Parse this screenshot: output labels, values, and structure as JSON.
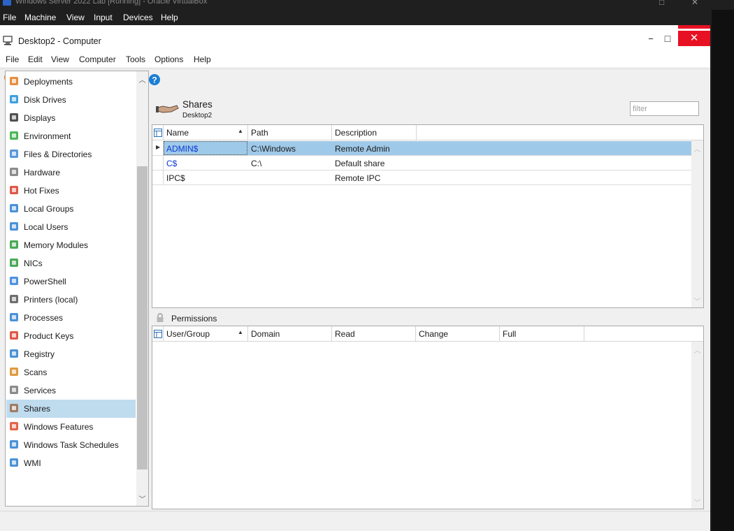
{
  "host": {
    "title": "Windows Server 2022 Lab [Running] - Oracle VirtualBox",
    "menu": [
      "File",
      "Machine",
      "View",
      "Input",
      "Devices",
      "Help"
    ]
  },
  "window": {
    "title": "Desktop2 - Computer",
    "minimize": "−",
    "maximize": "□",
    "close": "✕"
  },
  "menu": [
    "File",
    "Edit",
    "View",
    "Computer",
    "Tools",
    "Options",
    "Help"
  ],
  "toolbar": {
    "icons": [
      "search-icon",
      "tools-icon",
      "print-icon",
      "back-icon",
      "forward-icon",
      "cut-icon",
      "copy-icon",
      "paste-icon",
      "help-icon"
    ]
  },
  "nav": {
    "items": [
      {
        "label": "Deployments",
        "icon": "deployments-icon",
        "color": "#e07a1f"
      },
      {
        "label": "Disk Drives",
        "icon": "disk-icon",
        "color": "#1f8fd8"
      },
      {
        "label": "Displays",
        "icon": "monitor-icon",
        "color": "#333333"
      },
      {
        "label": "Environment",
        "icon": "environment-icon",
        "color": "#2faa3a"
      },
      {
        "label": "Files & Directories",
        "icon": "file-icon",
        "color": "#3d86d6"
      },
      {
        "label": "Hardware",
        "icon": "wrench-icon",
        "color": "#777777"
      },
      {
        "label": "Hot Fixes",
        "icon": "hotfix-icon",
        "color": "#d83b2a"
      },
      {
        "label": "Local Groups",
        "icon": "group-icon",
        "color": "#2c7fd0"
      },
      {
        "label": "Local Users",
        "icon": "user-icon",
        "color": "#2c7fd0"
      },
      {
        "label": "Memory Modules",
        "icon": "memory-icon",
        "color": "#2a9a3a"
      },
      {
        "label": "NICs",
        "icon": "nic-icon",
        "color": "#2a9a3a"
      },
      {
        "label": "PowerShell",
        "icon": "powershell-icon",
        "color": "#2f7fd8"
      },
      {
        "label": "Printers (local)",
        "icon": "printer-icon",
        "color": "#555555"
      },
      {
        "label": "Processes",
        "icon": "processes-icon",
        "color": "#2a7fd0"
      },
      {
        "label": "Product Keys",
        "icon": "key-icon",
        "color": "#d83b2a"
      },
      {
        "label": "Registry",
        "icon": "registry-icon",
        "color": "#2a7fd0"
      },
      {
        "label": "Scans",
        "icon": "search-icon",
        "color": "#d88a1f"
      },
      {
        "label": "Services",
        "icon": "services-icon",
        "color": "#777777"
      },
      {
        "label": "Shares",
        "icon": "share-hand-icon",
        "color": "#9a6a4a"
      },
      {
        "label": "Windows Features",
        "icon": "windows-features-icon",
        "color": "#e0482a"
      },
      {
        "label": "Windows Task Schedules",
        "icon": "calendar-icon",
        "color": "#2a7fd0"
      },
      {
        "label": "WMI",
        "icon": "wmi-icon",
        "color": "#2a7fd0"
      }
    ],
    "selected": "Shares"
  },
  "header": {
    "title": "Shares",
    "subtitle": "Desktop2",
    "filter_placeholder": "filter"
  },
  "shares_table": {
    "columns": [
      "Name",
      "Path",
      "Description"
    ],
    "rows": [
      {
        "name": "ADMIN$",
        "path": "C:\\Windows",
        "description": "Remote Admin",
        "selected": true,
        "link": true
      },
      {
        "name": "C$",
        "path": "C:\\",
        "description": "Default share",
        "selected": false,
        "link": true
      },
      {
        "name": "IPC$",
        "path": "",
        "description": "Remote IPC",
        "selected": false,
        "link": false
      }
    ]
  },
  "permissions": {
    "label": "Permissions",
    "columns": [
      "User/Group",
      "Domain",
      "Read",
      "Change",
      "Full"
    ],
    "rows": []
  },
  "colors": {
    "selection": "#9fc9e8",
    "nav_selection": "#bfdcef",
    "link": "#0a3bd6",
    "close": "#e81123"
  }
}
